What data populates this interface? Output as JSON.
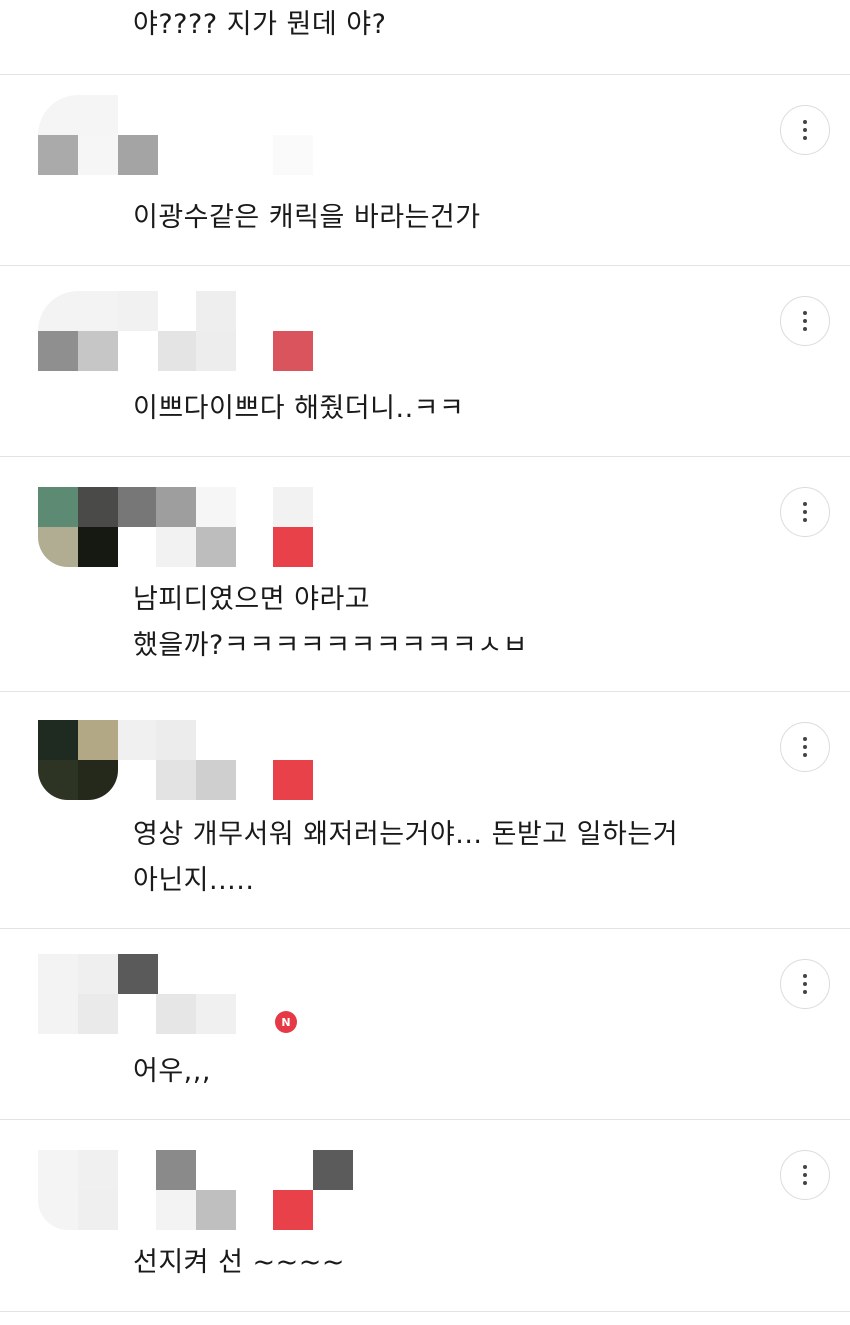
{
  "comments": [
    {
      "text": "야???? 지가 뭔데 야?"
    },
    {
      "text": "이광수같은 캐릭을 바라는건가"
    },
    {
      "text": "이쁘다이쁘다 해줬더니..ㅋㅋ"
    },
    {
      "text": "남피디였으면 야라고\n했을까?ㅋㅋㅋㅋㅋㅋㅋㅋㅋㅋㅅㅂ"
    },
    {
      "text": "영상 개무서워 왜저러는거야... 돈받고 일하는거\n아닌지....."
    },
    {
      "text": "어우,,,",
      "badge": "N"
    },
    {
      "text": "선지켜 선 ~~~~"
    }
  ],
  "icons": {
    "more": "more-vertical-icon",
    "avatar": "blurred-avatar"
  },
  "colors": {
    "accent": "#e63946",
    "divider": "#e4e4e4"
  }
}
